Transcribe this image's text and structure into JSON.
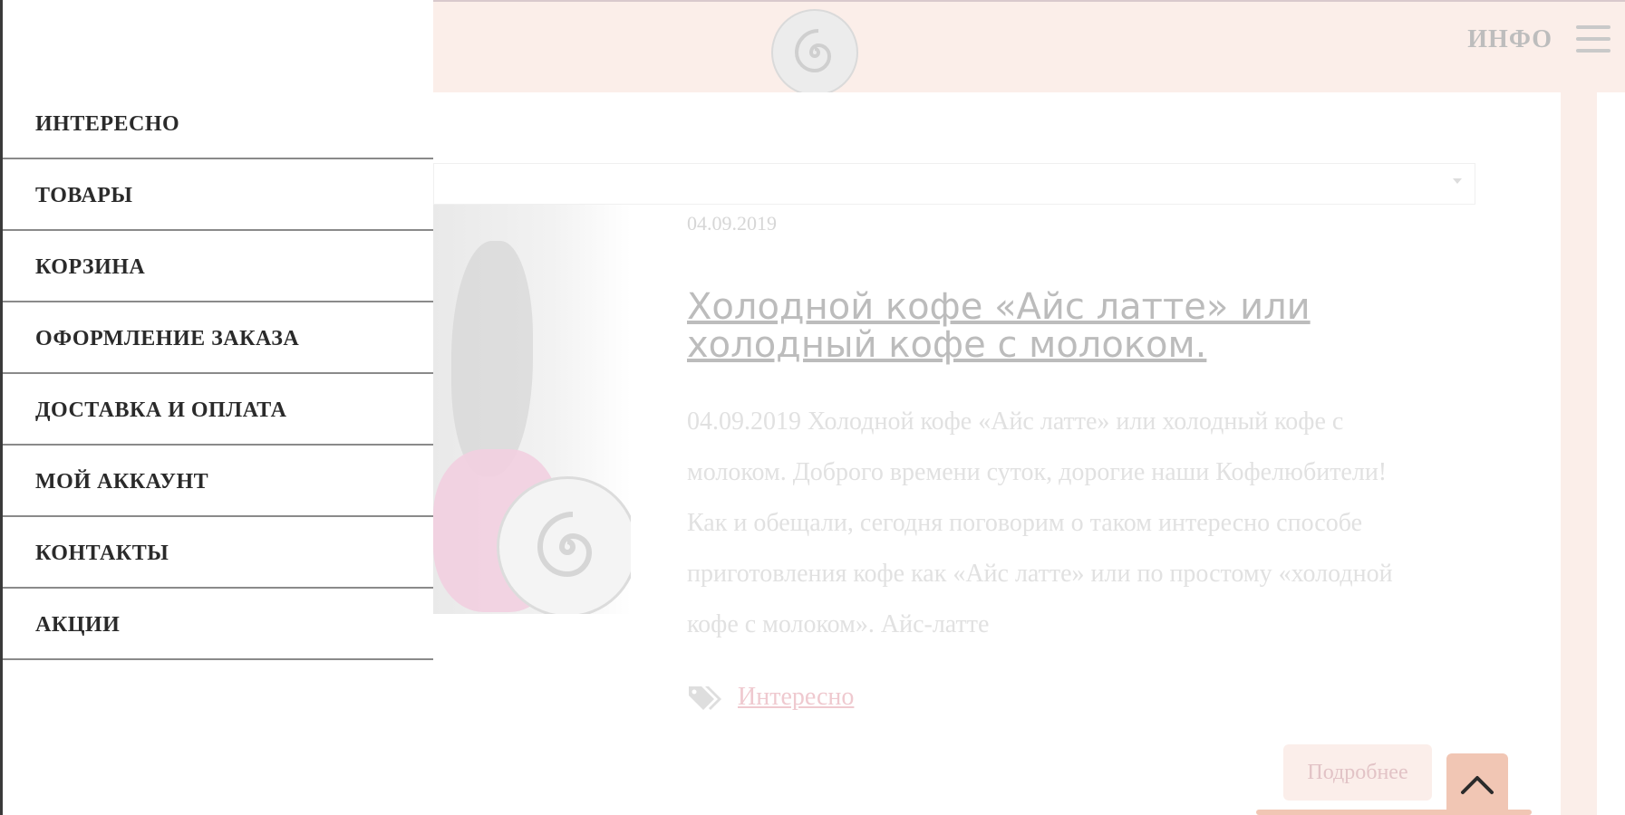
{
  "header": {
    "info_label": "ИНФО"
  },
  "menu": {
    "items": [
      {
        "label": "ИНТЕРЕСНО"
      },
      {
        "label": "ТОВАРЫ"
      },
      {
        "label": "КОРЗИНА"
      },
      {
        "label": "ОФОРМЛЕНИЕ ЗАКАЗА"
      },
      {
        "label": "ДОСТАВКА И ОПЛАТА"
      },
      {
        "label": "МОЙ АККАУНТ"
      },
      {
        "label": "КОНТАКТЫ"
      },
      {
        "label": "АКЦИИ"
      }
    ]
  },
  "post": {
    "date": "04.09.2019",
    "title": "Холодной кофе «Айс латте» или холодный кофе с молоком.",
    "excerpt": "04.09.2019   Холодной кофе «Айс латте» или холодный кофе с молоком.   Доброго времени суток, дорогие наши Кофелюбители! Как и обещали, сегодня поговорим о таком интересно способе приготовления кофе как «Айс латте» или по простому «холодной кофе с молоком».  Айс-латте",
    "tag": "Интересно",
    "more_label": "Подробнее"
  },
  "colors": {
    "header_bg": "#fbeee9",
    "accent": "#f1c6b4",
    "menu_text": "#2a2a2a"
  },
  "icons": {
    "logo": "spiral-logo-icon",
    "menu": "hamburger-icon",
    "tags": "tags-icon",
    "scroll_top": "chevron-up-icon"
  }
}
